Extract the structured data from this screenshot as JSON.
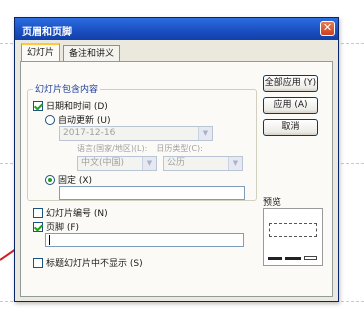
{
  "dialog": {
    "title": "页眉和页脚",
    "close_symbol": "✕"
  },
  "tabs": [
    {
      "label": "幻灯片",
      "active": true
    },
    {
      "label": "备注和讲义",
      "active": false
    }
  ],
  "group": {
    "title": "幻灯片包含内容",
    "date_time_label": "日期和时间 (D)",
    "date_time_checked": true,
    "auto_update_label": "自动更新 (U)",
    "auto_update_selected": false,
    "date_value": "2017-12-16",
    "language_label": "语言(国家/地区)(L):",
    "language_value": "中文(中国)",
    "calendar_label": "日历类型(C):",
    "calendar_value": "公历",
    "fixed_label": "固定 (X)",
    "fixed_selected": true,
    "fixed_value": ""
  },
  "slide_number": {
    "label": "幻灯片编号 (N)",
    "checked": false
  },
  "footer": {
    "label": "页脚 (F)",
    "checked": true,
    "value": ""
  },
  "title_slide": {
    "label": "标题幻灯片中不显示 (S)",
    "checked": false
  },
  "buttons": {
    "apply_all": "全部应用 (Y)",
    "apply": "应用 (A)",
    "cancel": "取消"
  },
  "preview": {
    "label": "预览"
  },
  "colors": {
    "accent": "#2d6ee0",
    "check": "#21a121",
    "arrow": "#d42020"
  }
}
